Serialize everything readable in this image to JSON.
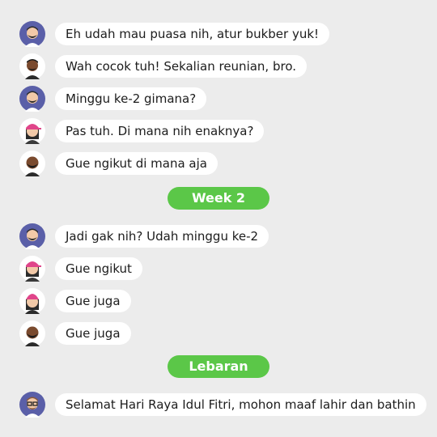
{
  "colors": {
    "background": "#ececec",
    "bubble": "#ffffff",
    "divider": "#5bc748",
    "avatar_circle": "#5a5fa8",
    "pink_cap": "#e0458a"
  },
  "messages_week1": [
    {
      "avatar": "guy-beard-avatar",
      "text": "Eh udah mau puasa nih, atur bukber yuk!"
    },
    {
      "avatar": "dark-skin-guy-avatar",
      "text": "Wah cocok tuh! Sekalian reunian, bro."
    },
    {
      "avatar": "guy-beard-avatar",
      "text": "Minggu ke-2 gimana?"
    },
    {
      "avatar": "girl-pink-cap-avatar",
      "text": "Pas tuh. Di mana nih enaknya?"
    },
    {
      "avatar": "bald-guy-beard-avatar",
      "text": "Gue ngikut di mana aja"
    }
  ],
  "divider_week2": "Week 2",
  "messages_week2": [
    {
      "avatar": "guy-beard-avatar",
      "text": "Jadi gak nih? Udah minggu ke-2"
    },
    {
      "avatar": "girl-pink-cap-avatar",
      "text": "Gue ngikut"
    },
    {
      "avatar": "girl-pink-beanie-avatar",
      "text": "Gue juga"
    },
    {
      "avatar": "bald-guy-beard-avatar",
      "text": "Gue juga"
    }
  ],
  "divider_lebaran": "Lebaran",
  "messages_lebaran": [
    {
      "avatar": "guy-glasses-avatar",
      "text": "Selamat Hari Raya Idul Fitri, mohon maaf lahir dan bathin"
    }
  ]
}
